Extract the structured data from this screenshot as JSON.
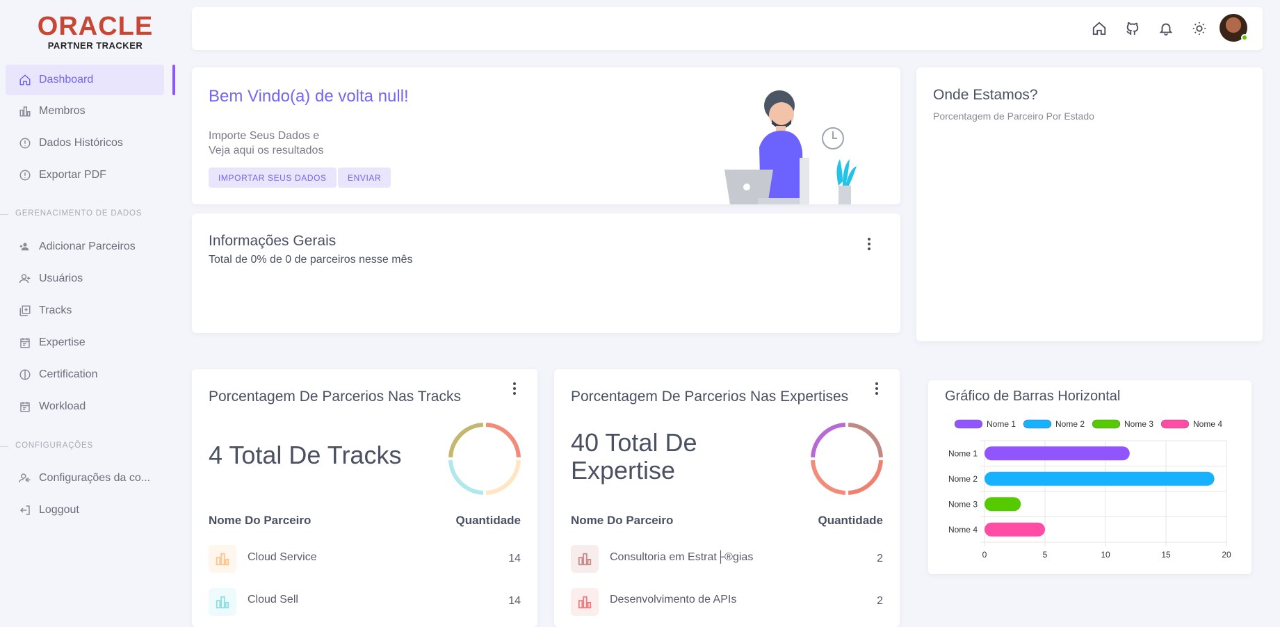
{
  "logo": {
    "brand": "ORACLE",
    "sub": "PARTNER TRACKER"
  },
  "sidebar": {
    "items": [
      {
        "label": "Dashboard",
        "icon": "home-icon",
        "active": true
      },
      {
        "label": "Membros",
        "icon": "chart-bar-icon"
      },
      {
        "label": "Dados Históricos",
        "icon": "alert-circle-icon"
      },
      {
        "label": "Exportar PDF",
        "icon": "alert-circle-icon"
      }
    ],
    "section1": "GERENACIMENTO DE DADOS",
    "items2": [
      {
        "label": "Adicionar Parceiros",
        "icon": "account-group-icon"
      },
      {
        "label": "Usuários",
        "icon": "account-plus-icon"
      },
      {
        "label": "Tracks",
        "icon": "library-add-icon"
      },
      {
        "label": "Expertise",
        "icon": "calendar-icon"
      },
      {
        "label": "Certification",
        "icon": "half-circle-icon"
      },
      {
        "label": "Workload",
        "icon": "calendar-icon"
      }
    ],
    "section2": "CONFIGURAÇÕES",
    "items3": [
      {
        "label": "Configurações da co...",
        "icon": "account-cog-icon"
      },
      {
        "label": "Loggout",
        "icon": "logout-icon"
      }
    ]
  },
  "topbar": {
    "icons": [
      "home-icon",
      "github-icon",
      "bell-icon",
      "sun-icon"
    ]
  },
  "welcome": {
    "title": "Bem Vindo(a) de volta null!",
    "line1": "Importe Seus Dados e",
    "line2": "Veja aqui os resultados",
    "btn_import": "IMPORTAR SEUS DADOS",
    "btn_send": "ENVIAR"
  },
  "info": {
    "title": "Informações Gerais",
    "subtitle": "Total de 0% de 0 de parceiros nesse mês"
  },
  "map": {
    "title": "Onde Estamos?",
    "subtitle": "Porcentagem de Parceiro Por Estado"
  },
  "tracks": {
    "title": "Porcentagem De Parcerios Nas Tracks",
    "total": "4 Total De Tracks",
    "col_name": "Nome Do Parceiro",
    "col_qty": "Quantidade",
    "rows": [
      {
        "name": "Cloud Service",
        "qty": "14",
        "color": "#ffd9a8"
      },
      {
        "name": "Cloud Sell",
        "qty": "14",
        "color": "#a8e6ea"
      }
    ],
    "donut_colors": [
      "#f28b7a",
      "#ffe6c2",
      "#b0e8ec",
      "#c4b870"
    ]
  },
  "expertise": {
    "title": "Porcentagem De Parcerios Nas Expertises",
    "total_line1": "40 Total De",
    "total_line2": "Expertise",
    "col_name": "Nome Do Parceiro",
    "col_qty": "Quantidade",
    "rows": [
      {
        "name": "Consultoria em Estrat├®gias",
        "qty": "2",
        "color": "#c98a8a"
      },
      {
        "name": "Desenvolvimento de APIs",
        "qty": "2",
        "color": "#f27a7a"
      }
    ],
    "donut_colors": [
      "#c08a84",
      "#f08070",
      "#f28b7a",
      "#b76ad6"
    ]
  },
  "bar_chart_card": {
    "title": "Gráfico de Barras Horizontal"
  },
  "chart_data": {
    "type": "bar",
    "orientation": "horizontal",
    "title": "Gráfico de Barras Horizontal",
    "categories": [
      "Nome 1",
      "Nome 2",
      "Nome 3",
      "Nome 4"
    ],
    "values": [
      12,
      19,
      3,
      5
    ],
    "colors": [
      "#9055fd",
      "#16b1ff",
      "#56ca00",
      "#ff4ca5"
    ],
    "legend": [
      "Nome 1",
      "Nome 2",
      "Nome 3",
      "Nome 4"
    ],
    "xlim": [
      0,
      20
    ],
    "xticks": [
      "0",
      "5",
      "10",
      "15",
      "20"
    ],
    "grid": true,
    "legend_position": "top"
  }
}
